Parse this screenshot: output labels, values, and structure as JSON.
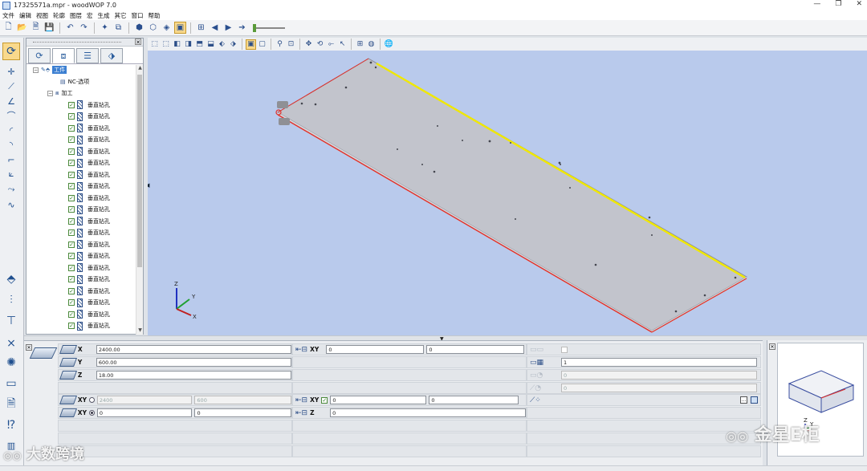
{
  "window": {
    "title": "17325571a.mpr - woodWOP 7.0",
    "controls": [
      "—",
      "❐",
      "✕"
    ]
  },
  "menu": [
    "文件",
    "编辑",
    "视图",
    "轮廓",
    "图层",
    "宏",
    "生成",
    "其它",
    "窗口",
    "帮助"
  ],
  "toolbar_icons": [
    "new-file-icon",
    "open-folder-icon",
    "new-template-icon",
    "save-icon",
    "undo-icon",
    "redo-icon",
    "new-workpiece-icon",
    "copy-icon",
    "box-view-icon",
    "box-outline-icon",
    "box-shaded-icon",
    "simulation-icon",
    "arrow-left-icon",
    "play-icon",
    "arrow-right-icon"
  ],
  "tree": {
    "root": "工件",
    "nc_option": "NC-选项",
    "machining": "加工",
    "drill_items": [
      "垂直钻孔",
      "垂直钻孔",
      "垂直钻孔",
      "垂直钻孔",
      "垂直钻孔",
      "垂直钻孔",
      "垂直钻孔",
      "垂直钻孔",
      "垂直钻孔",
      "垂直钻孔",
      "垂直钻孔",
      "垂直钻孔",
      "垂直钻孔",
      "垂直钻孔",
      "垂直钻孔",
      "垂直钻孔",
      "垂直钻孔",
      "垂直钻孔",
      "垂直钻孔",
      "垂直钻孔"
    ]
  },
  "axes": {
    "x": "X",
    "y": "Y",
    "z": "Z"
  },
  "workpiece": {
    "x_label": "X",
    "x_value": "2400.00",
    "y_label": "Y",
    "y_value": "600.00",
    "z_label": "Z",
    "z_value": "18.00",
    "offset_label": "XY",
    "offset_x": "0",
    "offset_y": "0",
    "count_value": "1",
    "zero_label": "XY",
    "zero_x_disabled": "2400",
    "zero_y_disabled": "600",
    "zero2_label": "XY",
    "zero2_x": "0",
    "zero2_y": "0",
    "mid_label": "XY",
    "mid_x": "0",
    "mid_y": "0",
    "z_offset_label": "Z",
    "z_offset": "0",
    "disabled_values": [
      "0",
      "0"
    ]
  },
  "nav_cube": {
    "z": "Z",
    "y": "Y"
  },
  "watermarks": {
    "left": "大数跨境",
    "right": "金星E柜"
  },
  "colors": {
    "viewport": "#b9caec",
    "edge_red": "#e0302a",
    "edge_yellow": "#f0e800",
    "panel_top": "#c2c4cc"
  }
}
